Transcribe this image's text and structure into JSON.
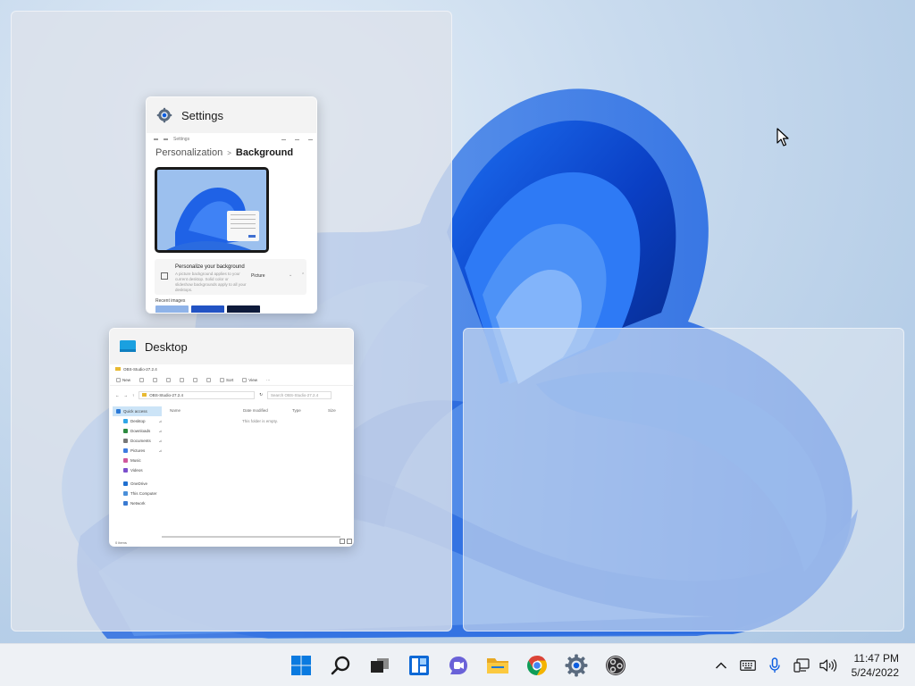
{
  "desktop": {
    "wallpaper": "windows-11-bloom",
    "accent": "#0a5ce0"
  },
  "snap_assist": {
    "windows": [
      {
        "id": "settings",
        "title": "Settings",
        "icon": "gear-icon",
        "content": {
          "window_caption": "Settings",
          "breadcrumb_parent": "Personalization",
          "breadcrumb_separator": ">",
          "breadcrumb_current": "Background",
          "card_title": "Personalize your background",
          "card_desc": "A picture background applies to your current desktop. Solid color or slideshow backgrounds apply to all your desktops.",
          "card_select": "Picture",
          "recent_label": "Recent images"
        }
      },
      {
        "id": "desktop",
        "title": "Desktop",
        "icon": "desktop-icon",
        "content": {
          "window_caption": "OBS-Studio-27.2.4",
          "new_label": "New",
          "sort_label": "Sort",
          "view_label": "View",
          "more_label": "···",
          "address_path": "OBS-Studio-27.2.4",
          "search_placeholder": "Search OBS-Studio-27.2.4",
          "columns": [
            "Name",
            "Date modified",
            "Type",
            "Size"
          ],
          "empty_message": "This folder is empty.",
          "nav": [
            {
              "label": "Quick access",
              "pinned": false,
              "color": "#2b79d7"
            },
            {
              "label": "Desktop",
              "pinned": true,
              "color": "#2fa6e8"
            },
            {
              "label": "Downloads",
              "pinned": true,
              "color": "#2c8a3f"
            },
            {
              "label": "Documents",
              "pinned": true,
              "color": "#777777"
            },
            {
              "label": "Pictures",
              "pinned": true,
              "color": "#3d7be0"
            },
            {
              "label": "Music",
              "pinned": false,
              "color": "#d0579c"
            },
            {
              "label": "Videos",
              "pinned": false,
              "color": "#7b4fcc"
            },
            {
              "label": "OneDrive",
              "pinned": false,
              "color": "#1f6fd0"
            },
            {
              "label": "This Computer",
              "pinned": false,
              "color": "#4a8fd9"
            },
            {
              "label": "Network",
              "pinned": false,
              "color": "#3a7ad1"
            }
          ],
          "status": "0 items"
        }
      }
    ]
  },
  "taskbar": {
    "apps": [
      {
        "name": "start",
        "icon": "windows-logo-icon"
      },
      {
        "name": "search",
        "icon": "search-icon"
      },
      {
        "name": "task-view",
        "icon": "task-view-icon"
      },
      {
        "name": "widgets",
        "icon": "widgets-icon"
      },
      {
        "name": "teams-chat",
        "icon": "chat-icon"
      },
      {
        "name": "file-explorer",
        "icon": "folder-icon"
      },
      {
        "name": "chrome",
        "icon": "chrome-icon"
      },
      {
        "name": "settings",
        "icon": "gear-icon"
      },
      {
        "name": "obs-studio",
        "icon": "obs-icon"
      }
    ],
    "tray": {
      "overflow": "chevron-up-icon",
      "keyboard": "keyboard-icon",
      "microphone": "microphone-icon",
      "network": "network-icon",
      "volume": "volume-icon"
    },
    "clock": {
      "time": "11:47 PM",
      "date": "5/24/2022"
    }
  }
}
